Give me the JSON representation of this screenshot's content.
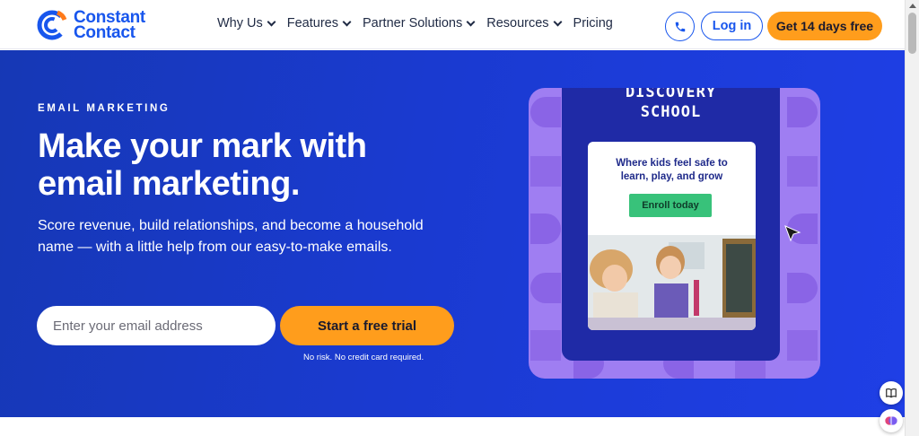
{
  "brand": {
    "name_line1": "Constant",
    "name_line2": "Contact",
    "color": "#1856ed"
  },
  "nav": {
    "items": [
      {
        "label": "Why Us",
        "has_dropdown": true
      },
      {
        "label": "Features",
        "has_dropdown": true
      },
      {
        "label": "Partner Solutions",
        "has_dropdown": true
      },
      {
        "label": "Resources",
        "has_dropdown": true
      },
      {
        "label": "Pricing",
        "has_dropdown": false
      }
    ],
    "phone_icon": "phone-icon",
    "login_label": "Log in",
    "cta_label": "Get 14 days free"
  },
  "hero": {
    "eyebrow": "EMAIL MARKETING",
    "headline": "Make your mark with email marketing.",
    "subtext": "Score revenue, build relationships, and become a household name — with a little help from our easy-to-make emails.",
    "email_placeholder": "Enter your email address",
    "trial_label": "Start a free trial",
    "fineprint": "No risk. No credit card required.",
    "background_color": "#1a3ad0",
    "accent_color": "#ff9d1c"
  },
  "promo": {
    "school_title_line1": "DISCOVERY",
    "school_title_line2": "SCHOOL",
    "tagline_line1": "Where kids feel safe to",
    "tagline_line2": "learn, play, and grow",
    "button_label": "Enroll today",
    "frame_color": "#9f7ef2",
    "button_color": "#38c27a"
  },
  "floating": {
    "book_icon": "book-icon",
    "assistant_icon": "brain-icon"
  }
}
